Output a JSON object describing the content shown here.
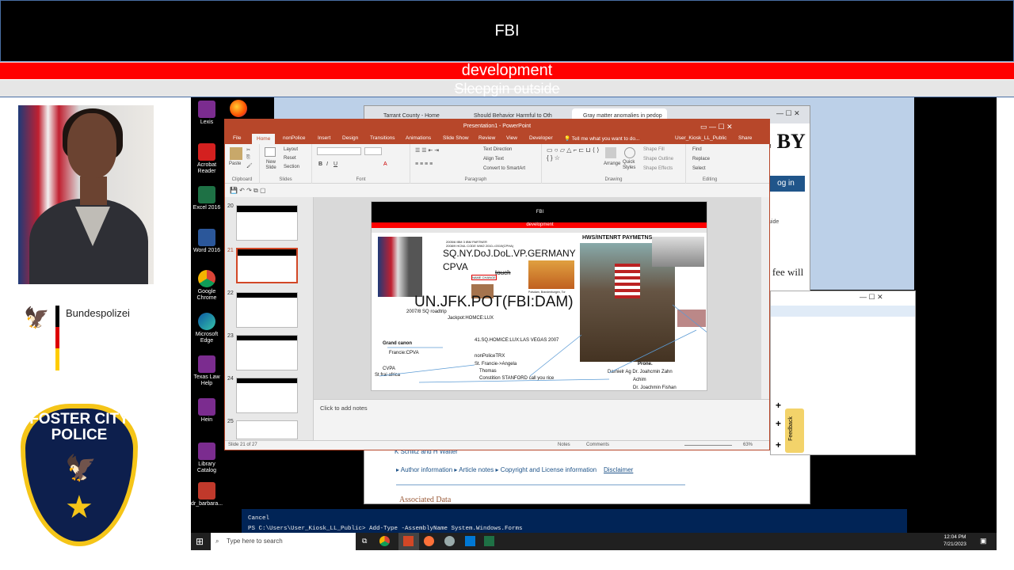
{
  "header": {
    "title": "FBI",
    "red_bar": "development",
    "gray_bar": "Sleepgin outside"
  },
  "left": {
    "org": "Bundespolizei",
    "badge_text": "FOSTER CITY POLICE"
  },
  "desktop_icons": [
    {
      "label": "Lexis"
    },
    {
      "label": "Acrobat Reader"
    },
    {
      "label": "Excel 2016"
    },
    {
      "label": "Word 2016"
    },
    {
      "label": "Google Chrome"
    },
    {
      "label": "Microsoft Edge"
    },
    {
      "label": "Texas Law Help"
    },
    {
      "label": "Hein"
    },
    {
      "label": "Library Catalog"
    },
    {
      "label": "dr_barbara..."
    }
  ],
  "browser": {
    "tabs": [
      "Tarrant County - Home",
      "Should Behavior Harmful to Oth",
      "Gray matter anomalies in pedop"
    ],
    "page_heading_fragment": "DE BY",
    "login_button": "og in",
    "text_fragment_1": "uide",
    "text_fragment_2": "sing fee will be",
    "authors": [
      "K Schiltz",
      "H Walter"
    ],
    "author_links": [
      "Author information",
      "Article notes",
      "Copyright and License information",
      "Disclaimer"
    ],
    "associated_data": "Associated Data",
    "feedback": "Feedback"
  },
  "powershell": {
    "line1": "Cancel",
    "line2": "PS C:\\Users\\User_Kiosk_LL_Public> Add-Type -AssemblyName System.Windows.Forms"
  },
  "taskbar": {
    "search_placeholder": "Type here to search",
    "time": "12:04 PM",
    "date": "7/21/2023"
  },
  "powerpoint": {
    "title": "Presentation1 - PowerPoint",
    "tabs": [
      "File",
      "Home",
      "nonPolice",
      "Insert",
      "Design",
      "Transitions",
      "Animations",
      "Slide Show",
      "Review",
      "View",
      "Developer"
    ],
    "tell_me": "Tell me what you want to do...",
    "user": "User_Kiosk_LL_Public",
    "share": "Share",
    "ribbon_groups": [
      "Clipboard",
      "Slides",
      "Font",
      "Paragraph",
      "Drawing",
      "Editing"
    ],
    "ribbon_buttons": {
      "paste": "Paste",
      "new_slide": "New Slide",
      "layout": "Layout",
      "reset": "Reset",
      "section": "Section",
      "text_direction": "Text Direction",
      "align_text": "Align Text",
      "convert_smartart": "Convert to SmartArt",
      "arrange": "Arrange",
      "quick_styles": "Quick Styles",
      "shape_fill": "Shape Fill",
      "shape_outline": "Shape Outline",
      "shape_effects": "Shape Effects",
      "find": "Find",
      "replace": "Replace",
      "select": "Select"
    },
    "thumb_numbers": [
      "20",
      "21",
      "22",
      "23",
      "24",
      "25"
    ],
    "selected_slide": "21",
    "notes_placeholder": "Click to add notes",
    "status_slide": "Slide 21 of 27",
    "status_notes": "Notes",
    "status_comments": "Comments",
    "zoom": "63%"
  },
  "slide": {
    "title": "FBI",
    "subtitle": "development",
    "small1": "2005/6 IBM 3 IBM PARTNER",
    "small2": "2008/9 HCN/L CODE WW2 2010->2019(CPHA)",
    "main1": "SQ.NY.DoJ.DoL.VP.GERMANY",
    "main2": "CPVA",
    "touch": "touch",
    "name_change": "NAME CHANGE",
    "potsdam": "Potsdam, Brandenburgen, Tor",
    "big": "UN.JFK.POT(FBI:DAM)",
    "roadtrip": "2007/8 SQ roadtrip",
    "jackpot": "Jackpot:HOMCE:LUX",
    "hws": "HWS/INTENRT PAYMETNS",
    "grand_canon": "Grand canon",
    "cpva_line": "Francie:CPVA",
    "sqhomice": "41.SQ.HOMICE:LUX:LAS VEGAS 2007",
    "nonpolice": "nonPoliceTRX",
    "stfrancie": "St. Francie->Angela",
    "thomas": "Thomas",
    "stanford": "Constition STANFORD call you rice",
    "cpva2": "CVPA",
    "stfrai": "St frai africa",
    "prone": "Prone.",
    "names1": "Darnielr Ag Dr. Joahcmin Zahn",
    "names2": "Achim",
    "names3": "Dr. Joachmin Fishan"
  }
}
